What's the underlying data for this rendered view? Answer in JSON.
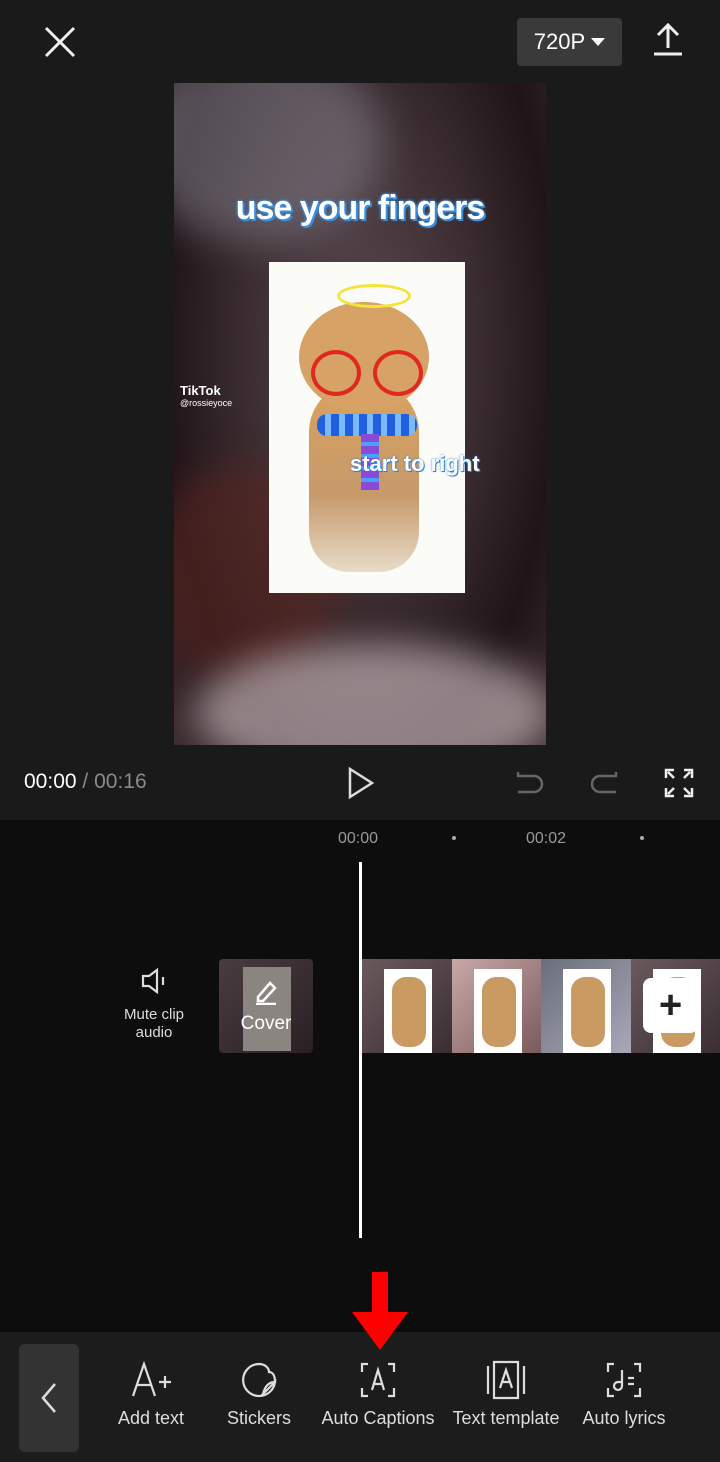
{
  "header": {
    "resolution": "720P"
  },
  "preview": {
    "headline": "use your fingers",
    "subtitle": "start to right",
    "watermark": "TikTok",
    "watermark_handle": "@rossieyoce"
  },
  "playback": {
    "current": "00:00",
    "separator": "/",
    "total": "00:16"
  },
  "timeline": {
    "ticks": [
      "00:00",
      "00:02"
    ],
    "mute_label": "Mute clip audio",
    "cover_label": "Cover",
    "add": "+",
    "frames": 4
  },
  "toolbar": {
    "items": [
      {
        "label": "Add text",
        "icon": "add-text-icon"
      },
      {
        "label": "Stickers",
        "icon": "sticker-icon"
      },
      {
        "label": "Auto Captions",
        "icon": "auto-captions-icon"
      },
      {
        "label": "Text template",
        "icon": "text-template-icon"
      },
      {
        "label": "Auto lyrics",
        "icon": "auto-lyrics-icon"
      }
    ]
  },
  "colors": {
    "annotation_arrow": "#ff0000",
    "background": "#0d0d0d",
    "panel": "#1a1a1a"
  }
}
